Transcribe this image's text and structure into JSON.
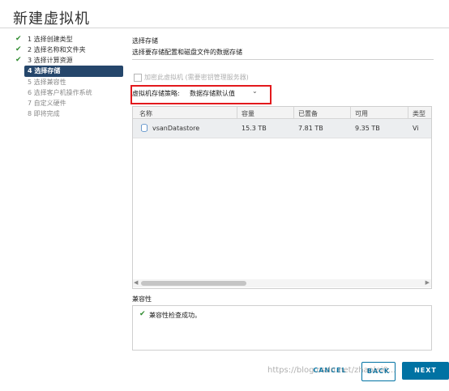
{
  "window": {
    "title": "新建虚拟机"
  },
  "steps": [
    {
      "label": "1 选择创建类型",
      "state": "done"
    },
    {
      "label": "2 选择名称和文件夹",
      "state": "done"
    },
    {
      "label": "3 选择计算资源",
      "state": "done"
    },
    {
      "label": "4 选择存储",
      "state": "active"
    },
    {
      "label": "5 选择兼容性",
      "state": "future"
    },
    {
      "label": "6 选择客户机操作系统",
      "state": "future"
    },
    {
      "label": "7 自定义硬件",
      "state": "future"
    },
    {
      "label": "8 即将完成",
      "state": "future"
    }
  ],
  "main": {
    "section_title": "选择存储",
    "section_subtitle": "选择要存储配置和磁盘文件的数据存储",
    "encrypt_checkbox_label": "加密此虚拟机 (需要密钥管理服务器)",
    "policy_label": "虚拟机存储策略:",
    "policy_value": "数据存储默认值"
  },
  "table": {
    "columns": [
      "名称",
      "容量",
      "已置备",
      "可用",
      "类型"
    ],
    "rows": [
      {
        "name": "vsanDatastore",
        "capacity": "15.3 TB",
        "provisioned": "7.81 TB",
        "free": "9.35 TB",
        "type": "Vi"
      }
    ]
  },
  "compatibility": {
    "title": "兼容性",
    "message": "兼容性检查成功。"
  },
  "buttons": {
    "cancel": "CANCEL",
    "back": "BACK",
    "next": "NEXT"
  },
  "watermark": "https://blog.csdn.net/zhaolei0..."
}
